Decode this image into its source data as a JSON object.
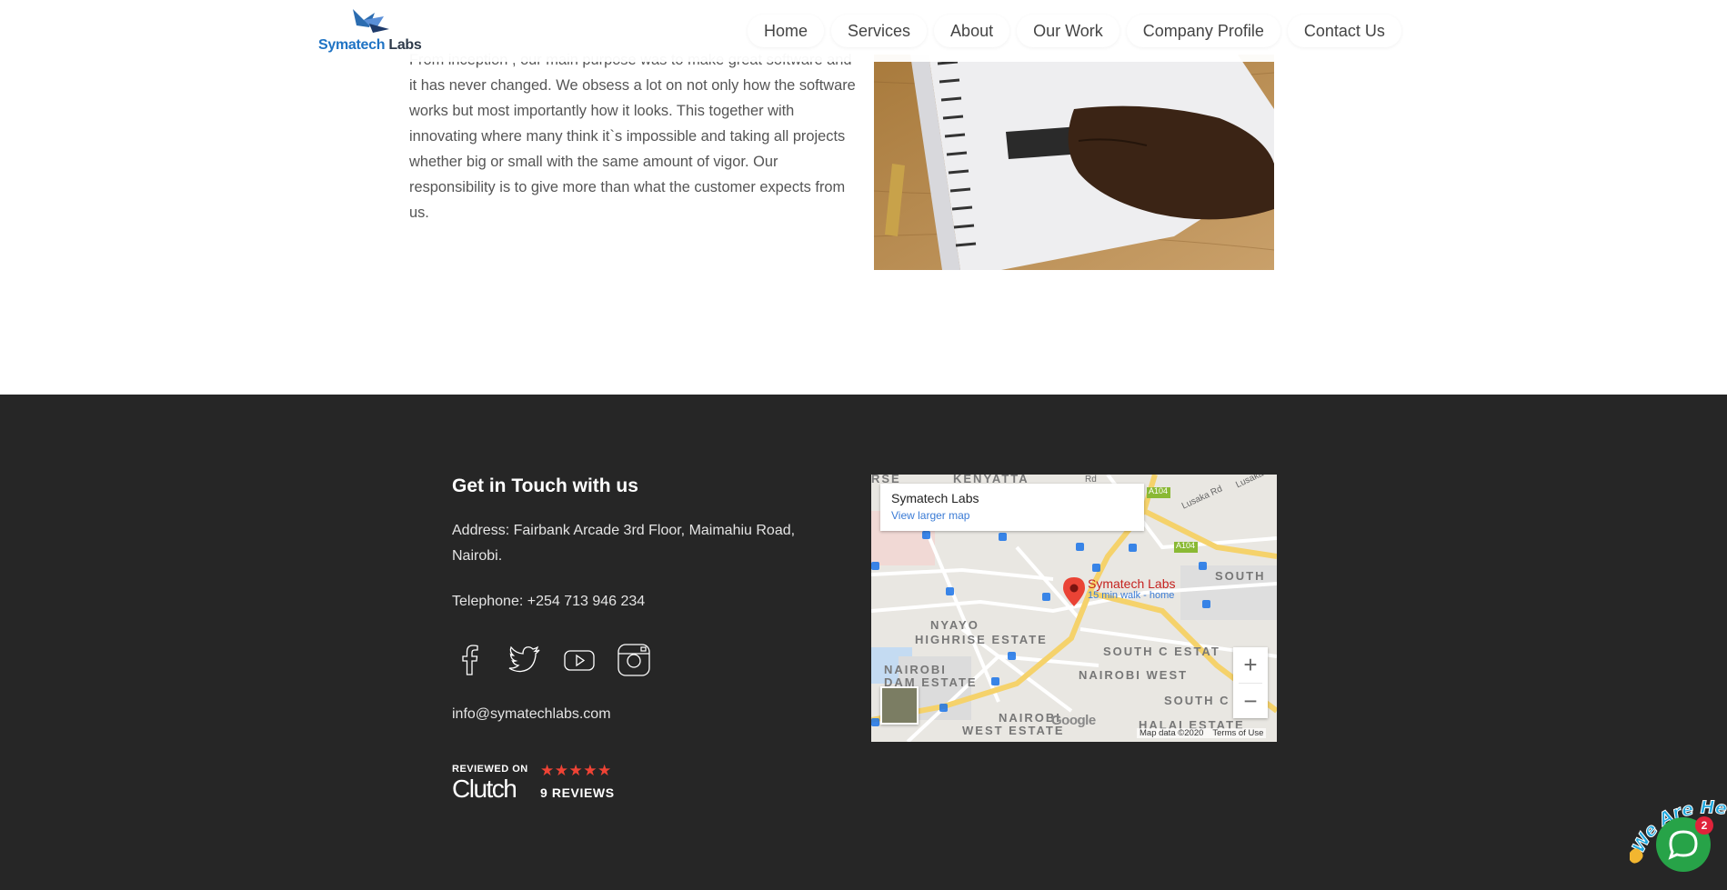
{
  "header": {
    "logo_part1": "Symatech",
    "logo_part2": " Labs",
    "nav": [
      "Home",
      "Services",
      "About",
      "Our Work",
      "Company Profile",
      "Contact Us"
    ]
  },
  "intro": {
    "paragraph": "From inception , our main purpose was to make great software and it has never changed. We obsess a lot on not only how the software works but most importantly how it looks. This together with innovating where many think it`s impossible and taking all projects whether big or small with the same amount of vigor. Our responsibility is to give more than what the customer expects from us."
  },
  "footer": {
    "title": "Get in Touch with us",
    "address": "Address: Fairbank Arcade 3rd Floor, Maimahiu Road, Nairobi.",
    "telephone": "Telephone: +254 713 946 234",
    "social_icons": [
      "facebook-icon",
      "twitter-icon",
      "youtube-icon",
      "instagram-icon"
    ],
    "email": "info@symatechlabs.com",
    "clutch": {
      "reviewed_on": "REVIEWED ON",
      "brand": "Clutch",
      "stars": "★★★★★",
      "reviews": "9 REVIEWS"
    }
  },
  "map": {
    "card_title": "Symatech Labs",
    "card_link": "View larger map",
    "place": "Symatech Labs",
    "place_sub": "15 min walk - home",
    "areas": {
      "a1": "KENYATTA",
      "a2": "NYAYO",
      "a3": "HIGHRISE ESTATE",
      "a4": "SOUTH",
      "a5": "SOUTH C ESTAT",
      "a6": "NAIROBI",
      "a7": "DAM ESTATE",
      "a8": "NAIROBI WEST",
      "a9": "SOUTH C",
      "a10": "NAIROBI",
      "a11": "WEST ESTATE",
      "a12": "HALAI ESTATE",
      "a13": "RSE"
    },
    "road_labels": {
      "r1": "A104",
      "r2": "A104",
      "r3": "Lusaka Rd",
      "r4": "Rd",
      "r5": "Lusaka"
    },
    "zoom_in": "+",
    "zoom_out": "−",
    "google": "Google",
    "map_data": "Map data ©2020",
    "terms": "Terms of Use"
  },
  "chat": {
    "banner": "We Are Here!",
    "badge": "2"
  }
}
